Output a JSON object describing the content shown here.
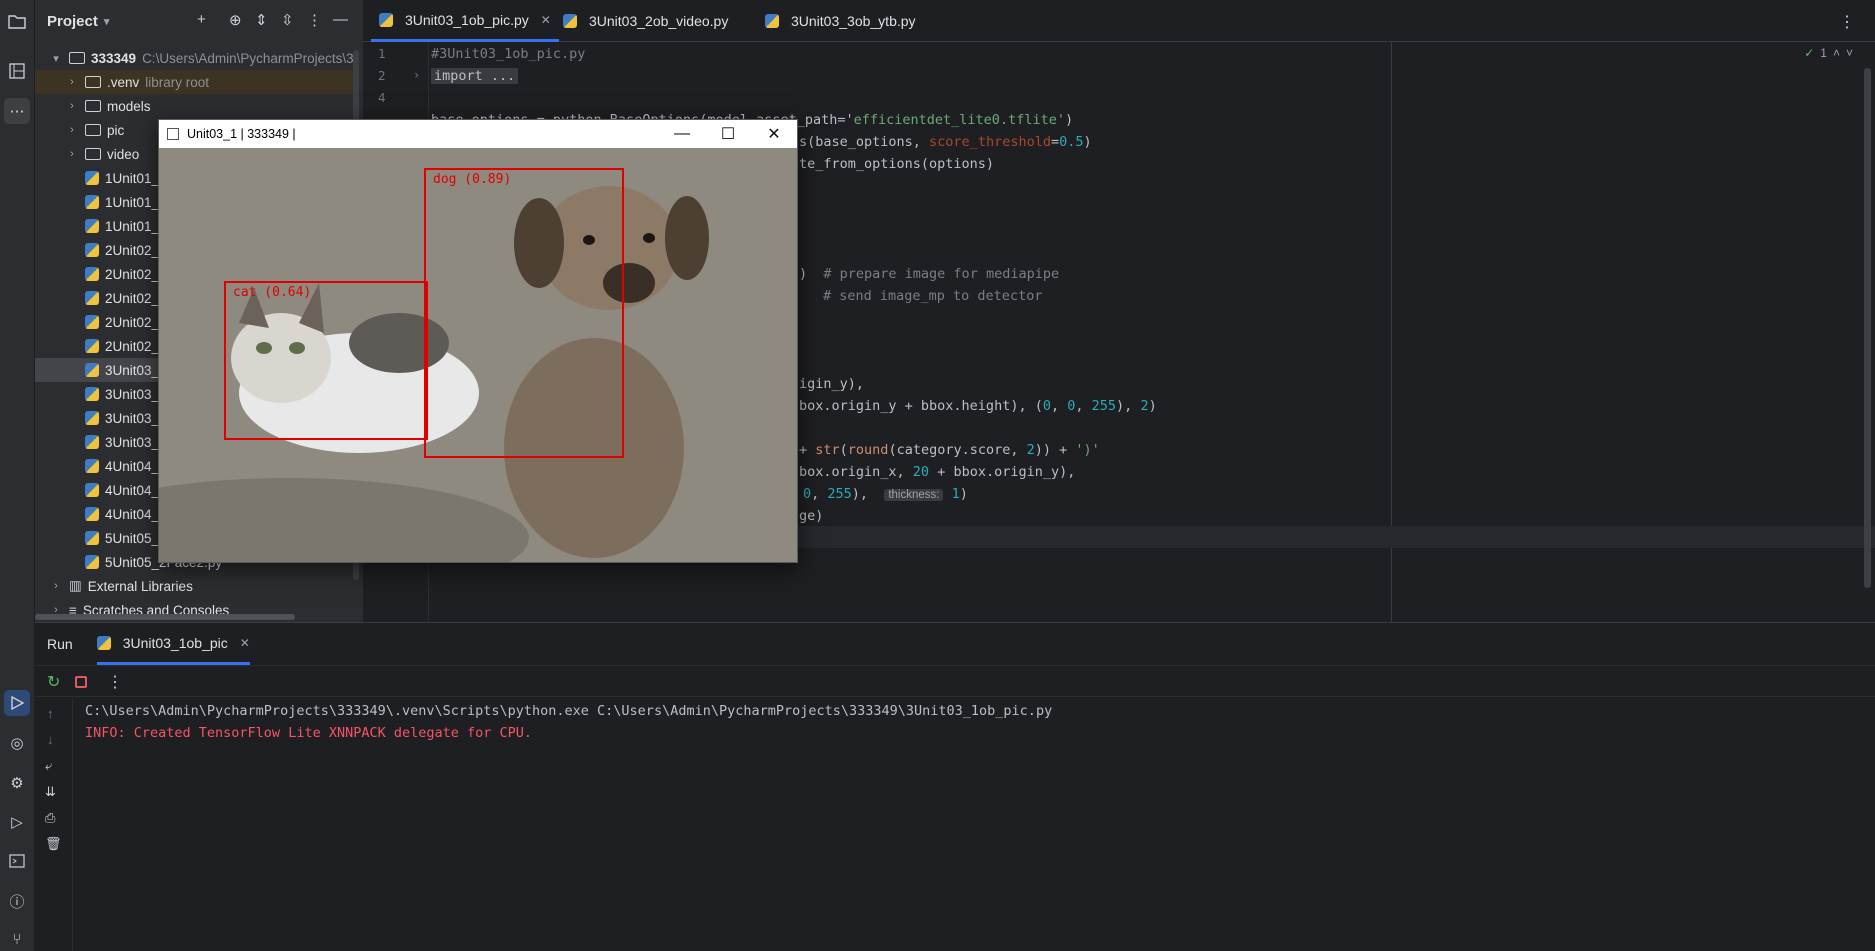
{
  "project_panel": {
    "title": "Project",
    "root": {
      "name": "333349",
      "path": "C:\\Users\\Admin\\PycharmProjects\\3"
    },
    "items": [
      {
        "label": ".venv",
        "extra": "library root",
        "kind": "folder"
      },
      {
        "label": "models",
        "kind": "folder"
      },
      {
        "label": "pic",
        "kind": "folder"
      },
      {
        "label": "video",
        "kind": "folder"
      },
      {
        "label": "1Unit01_",
        "kind": "py"
      },
      {
        "label": "1Unit01_",
        "kind": "py"
      },
      {
        "label": "1Unit01_",
        "kind": "py"
      },
      {
        "label": "2Unit02_",
        "kind": "py"
      },
      {
        "label": "2Unit02_",
        "kind": "py"
      },
      {
        "label": "2Unit02_",
        "kind": "py"
      },
      {
        "label": "2Unit02_",
        "kind": "py"
      },
      {
        "label": "2Unit02_",
        "kind": "py"
      },
      {
        "label": "3Unit03_",
        "kind": "py"
      },
      {
        "label": "3Unit03_",
        "kind": "py"
      },
      {
        "label": "3Unit03_",
        "kind": "py"
      },
      {
        "label": "3Unit03_",
        "kind": "py"
      },
      {
        "label": "4Unit04_",
        "kind": "py"
      },
      {
        "label": "4Unit04_",
        "kind": "py"
      },
      {
        "label": "4Unit04_",
        "kind": "py"
      },
      {
        "label": "5Unit05_",
        "kind": "py"
      },
      {
        "label": "5Unit05_2Face2.py",
        "kind": "py"
      }
    ],
    "external_libraries": "External Libraries",
    "scratches": "Scratches and Consoles"
  },
  "editor": {
    "tabs": [
      {
        "label": "3Unit03_1ob_pic.py",
        "active": true
      },
      {
        "label": "3Unit03_2ob_video.py",
        "active": false
      },
      {
        "label": "3Unit03_3ob_ytb.py",
        "active": false
      }
    ],
    "line_numbers": [
      "1",
      "2",
      "4"
    ],
    "inspection_count": "1",
    "lines": {
      "l1": "#3Unit03_1ob_pic.py",
      "l2": "import ...",
      "l5a": "base_options = python.BaseOptions(model_asset_path='",
      "l5b": "efficientdet_lite0.tflite'",
      "l5c": ")",
      "l6a": "s(base_options, ",
      "l6b": "score_threshold",
      "l6c": "=",
      "l6d": "0.5",
      "l6e": ")",
      "l7": "te_from_options(options)",
      "l12a": ")  ",
      "l12b": "# prepare image for mediapipe",
      "l13": "# send image_mp to detector",
      "l17": "igin_y),",
      "l18a": "box.origin_y + bbox.height), (",
      "l18b": "0",
      "l18c": ", ",
      "l18d": "0",
      "l18e": ", ",
      "l18f": "255",
      "l18g": "), ",
      "l18h": "2",
      "l18i": ")",
      "l20a": "+ ",
      "l20b": "str",
      "l20c": "(",
      "l20d": "round",
      "l20e": "(category.score, ",
      "l20f": "2",
      "l20g": ")) + ",
      "l20h": "')'",
      "l21a": "box.origin_x, ",
      "l21b": "20",
      "l21c": " + bbox.origin_y),",
      "l22a": "0",
      "l22b": ", ",
      "l22c": "255",
      "l22d": "),  ",
      "l22hint": "thickness:",
      "l22e": " 1",
      "l22f": ")",
      "l23": "ge)"
    }
  },
  "run_panel": {
    "title": "Run",
    "tab": "3Unit03_1ob_pic",
    "command": "C:\\Users\\Admin\\PycharmProjects\\333349\\.venv\\Scripts\\python.exe C:\\Users\\Admin\\PycharmProjects\\333349\\3Unit03_1ob_pic.py",
    "info": "INFO: Created TensorFlow Lite XNNPACK delegate for CPU."
  },
  "image_window": {
    "title": "Unit03_1 | 333349 |",
    "detections": [
      {
        "label": "dog (0.89)",
        "color": "#e00000"
      },
      {
        "label": "cat (0.64)",
        "color": "#e00000"
      }
    ]
  },
  "colors": {
    "accent": "#3574f0",
    "error_text": "#f75464",
    "bbox": "#e00000"
  }
}
